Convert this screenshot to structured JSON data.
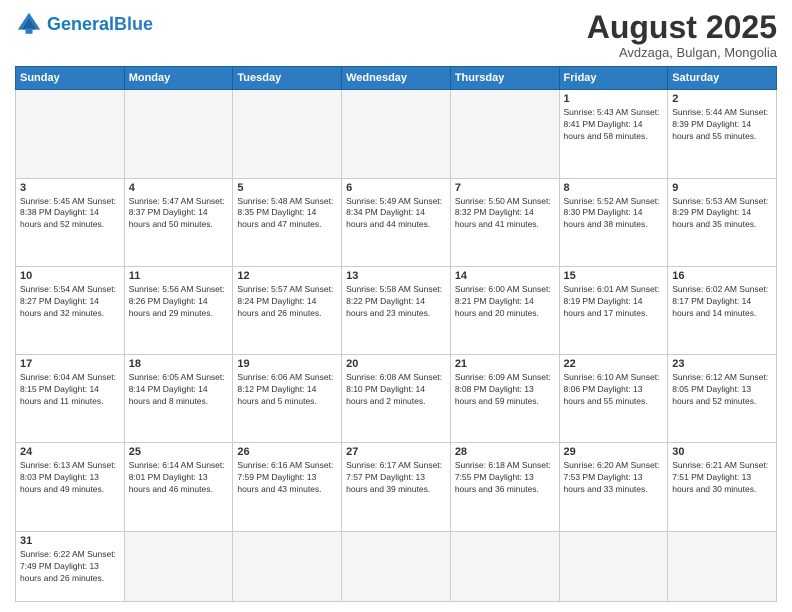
{
  "logo": {
    "text_general": "General",
    "text_blue": "Blue"
  },
  "header": {
    "month_year": "August 2025",
    "location": "Avdzaga, Bulgan, Mongolia"
  },
  "weekdays": [
    "Sunday",
    "Monday",
    "Tuesday",
    "Wednesday",
    "Thursday",
    "Friday",
    "Saturday"
  ],
  "weeks": [
    [
      {
        "day": "",
        "info": ""
      },
      {
        "day": "",
        "info": ""
      },
      {
        "day": "",
        "info": ""
      },
      {
        "day": "",
        "info": ""
      },
      {
        "day": "",
        "info": ""
      },
      {
        "day": "1",
        "info": "Sunrise: 5:43 AM\nSunset: 8:41 PM\nDaylight: 14 hours\nand 58 minutes."
      },
      {
        "day": "2",
        "info": "Sunrise: 5:44 AM\nSunset: 8:39 PM\nDaylight: 14 hours\nand 55 minutes."
      }
    ],
    [
      {
        "day": "3",
        "info": "Sunrise: 5:45 AM\nSunset: 8:38 PM\nDaylight: 14 hours\nand 52 minutes."
      },
      {
        "day": "4",
        "info": "Sunrise: 5:47 AM\nSunset: 8:37 PM\nDaylight: 14 hours\nand 50 minutes."
      },
      {
        "day": "5",
        "info": "Sunrise: 5:48 AM\nSunset: 8:35 PM\nDaylight: 14 hours\nand 47 minutes."
      },
      {
        "day": "6",
        "info": "Sunrise: 5:49 AM\nSunset: 8:34 PM\nDaylight: 14 hours\nand 44 minutes."
      },
      {
        "day": "7",
        "info": "Sunrise: 5:50 AM\nSunset: 8:32 PM\nDaylight: 14 hours\nand 41 minutes."
      },
      {
        "day": "8",
        "info": "Sunrise: 5:52 AM\nSunset: 8:30 PM\nDaylight: 14 hours\nand 38 minutes."
      },
      {
        "day": "9",
        "info": "Sunrise: 5:53 AM\nSunset: 8:29 PM\nDaylight: 14 hours\nand 35 minutes."
      }
    ],
    [
      {
        "day": "10",
        "info": "Sunrise: 5:54 AM\nSunset: 8:27 PM\nDaylight: 14 hours\nand 32 minutes."
      },
      {
        "day": "11",
        "info": "Sunrise: 5:56 AM\nSunset: 8:26 PM\nDaylight: 14 hours\nand 29 minutes."
      },
      {
        "day": "12",
        "info": "Sunrise: 5:57 AM\nSunset: 8:24 PM\nDaylight: 14 hours\nand 26 minutes."
      },
      {
        "day": "13",
        "info": "Sunrise: 5:58 AM\nSunset: 8:22 PM\nDaylight: 14 hours\nand 23 minutes."
      },
      {
        "day": "14",
        "info": "Sunrise: 6:00 AM\nSunset: 8:21 PM\nDaylight: 14 hours\nand 20 minutes."
      },
      {
        "day": "15",
        "info": "Sunrise: 6:01 AM\nSunset: 8:19 PM\nDaylight: 14 hours\nand 17 minutes."
      },
      {
        "day": "16",
        "info": "Sunrise: 6:02 AM\nSunset: 8:17 PM\nDaylight: 14 hours\nand 14 minutes."
      }
    ],
    [
      {
        "day": "17",
        "info": "Sunrise: 6:04 AM\nSunset: 8:15 PM\nDaylight: 14 hours\nand 11 minutes."
      },
      {
        "day": "18",
        "info": "Sunrise: 6:05 AM\nSunset: 8:14 PM\nDaylight: 14 hours\nand 8 minutes."
      },
      {
        "day": "19",
        "info": "Sunrise: 6:06 AM\nSunset: 8:12 PM\nDaylight: 14 hours\nand 5 minutes."
      },
      {
        "day": "20",
        "info": "Sunrise: 6:08 AM\nSunset: 8:10 PM\nDaylight: 14 hours\nand 2 minutes."
      },
      {
        "day": "21",
        "info": "Sunrise: 6:09 AM\nSunset: 8:08 PM\nDaylight: 13 hours\nand 59 minutes."
      },
      {
        "day": "22",
        "info": "Sunrise: 6:10 AM\nSunset: 8:06 PM\nDaylight: 13 hours\nand 55 minutes."
      },
      {
        "day": "23",
        "info": "Sunrise: 6:12 AM\nSunset: 8:05 PM\nDaylight: 13 hours\nand 52 minutes."
      }
    ],
    [
      {
        "day": "24",
        "info": "Sunrise: 6:13 AM\nSunset: 8:03 PM\nDaylight: 13 hours\nand 49 minutes."
      },
      {
        "day": "25",
        "info": "Sunrise: 6:14 AM\nSunset: 8:01 PM\nDaylight: 13 hours\nand 46 minutes."
      },
      {
        "day": "26",
        "info": "Sunrise: 6:16 AM\nSunset: 7:59 PM\nDaylight: 13 hours\nand 43 minutes."
      },
      {
        "day": "27",
        "info": "Sunrise: 6:17 AM\nSunset: 7:57 PM\nDaylight: 13 hours\nand 39 minutes."
      },
      {
        "day": "28",
        "info": "Sunrise: 6:18 AM\nSunset: 7:55 PM\nDaylight: 13 hours\nand 36 minutes."
      },
      {
        "day": "29",
        "info": "Sunrise: 6:20 AM\nSunset: 7:53 PM\nDaylight: 13 hours\nand 33 minutes."
      },
      {
        "day": "30",
        "info": "Sunrise: 6:21 AM\nSunset: 7:51 PM\nDaylight: 13 hours\nand 30 minutes."
      }
    ],
    [
      {
        "day": "31",
        "info": "Sunrise: 6:22 AM\nSunset: 7:49 PM\nDaylight: 13 hours\nand 26 minutes."
      },
      {
        "day": "",
        "info": ""
      },
      {
        "day": "",
        "info": ""
      },
      {
        "day": "",
        "info": ""
      },
      {
        "day": "",
        "info": ""
      },
      {
        "day": "",
        "info": ""
      },
      {
        "day": "",
        "info": ""
      }
    ]
  ]
}
